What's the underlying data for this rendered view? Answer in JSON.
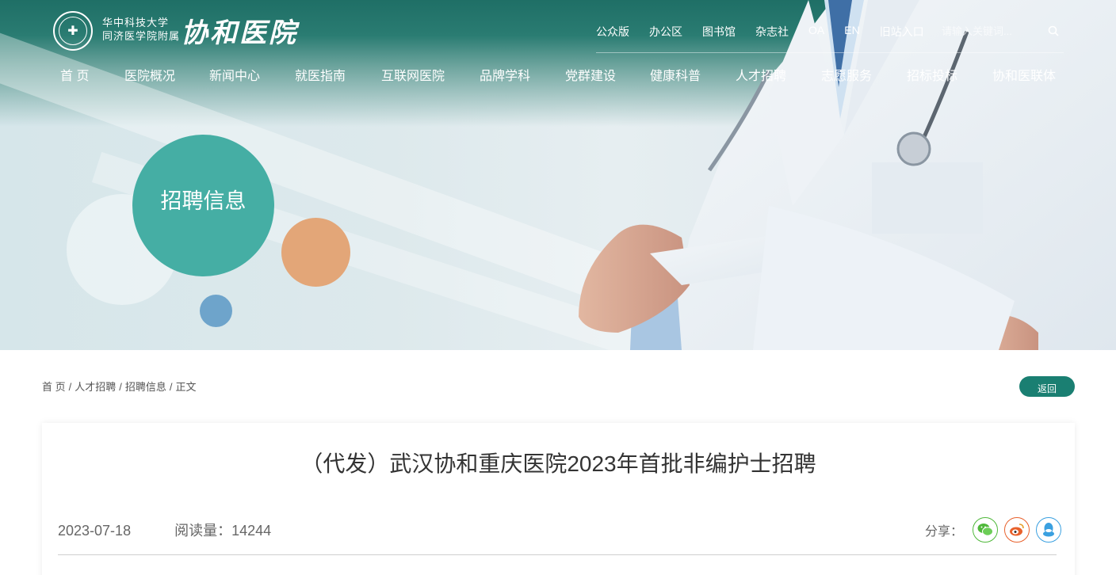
{
  "header": {
    "logo_line1": "华中科技大学",
    "logo_line2": "同济医学院附属",
    "logo_script": "协和医院",
    "top_links": [
      "公众版",
      "办公区",
      "图书馆",
      "杂志社",
      "OA",
      "EN",
      "旧站入口"
    ],
    "search_placeholder": "请输入关键词..."
  },
  "nav": [
    "首 页",
    "医院概况",
    "新闻中心",
    "就医指南",
    "互联网医院",
    "品牌学科",
    "党群建设",
    "健康科普",
    "人才招聘",
    "志愿服务",
    "招标投标",
    "协和医联体"
  ],
  "banner": {
    "section_title": "招聘信息"
  },
  "breadcrumb": [
    "首 页",
    "人才招聘",
    "招聘信息",
    "正文"
  ],
  "back_label": "返回",
  "article": {
    "title": "（代发）武汉协和重庆医院2023年首批非编护士招聘",
    "date": "2023-07-18",
    "views": "阅读量：14244",
    "share_label": "分享："
  },
  "colors": {
    "accent": "#1a7f72",
    "circle_teal": "#45aea4",
    "circle_orange": "#e3a678",
    "circle_blue": "#6ea4cb",
    "wechat": "#4fb83a",
    "weibo": "#e8612c",
    "qq": "#3aa0e0"
  },
  "icons": [
    "search-icon",
    "wechat-icon",
    "weibo-icon",
    "qq-icon",
    "hospital-emblem-icon"
  ]
}
